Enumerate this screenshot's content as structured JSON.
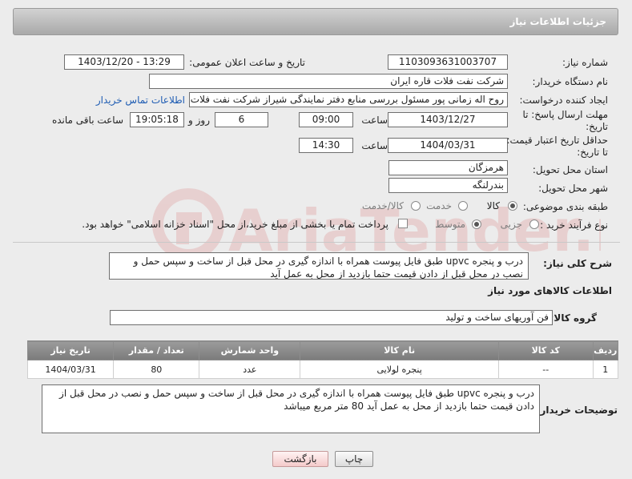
{
  "header": {
    "title": "جزئیات اطلاعات نیاز"
  },
  "form": {
    "need_number_label": "شماره نیاز:",
    "need_number": "1103093631003707",
    "announce_label": "تاریخ و ساعت اعلان عمومی:",
    "announce_value": "1403/12/20 - 13:29",
    "buyer_org_label": "نام دستگاه خریدار:",
    "buyer_org": "شرکت نفت فلات قاره ایران",
    "creator_label": "ایجاد کننده درخواست:",
    "creator": "روح اله زمانی پور مسئول بررسی منابع دفتر نمایندگی شیراز شرکت نفت فلات ق",
    "contact_link": "اطلاعات تماس خریدار",
    "deadline_label": "مهلت ارسال پاسخ: تا تاریخ:",
    "deadline_date": "1403/12/27",
    "time_label": "ساعت",
    "deadline_time": "09:00",
    "days_value": "6",
    "days_label": "روز و",
    "remaining_time": "19:05:18",
    "remaining_label": "ساعت باقی مانده",
    "validity_label": "حداقل تاریخ اعتبار قیمت: تا تاریخ:",
    "validity_date": "1404/03/31",
    "validity_time_label": "ساعت",
    "validity_time": "14:30",
    "province_label": "استان محل تحویل:",
    "province": "هرمزگان",
    "city_label": "شهر محل تحویل:",
    "city": "بندرلنگه",
    "category_label": "طبقه بندی موضوعی:",
    "category_options": [
      "کالا",
      "خدمت",
      "کالا/خدمت"
    ],
    "process_label": "نوع فرآیند خرید :",
    "process_options": [
      "جزیی",
      "متوسط"
    ],
    "payment_note": "پرداخت تمام یا بخشی از مبلغ خرید،از محل \"اسناد خزانه اسلامی\" خواهد بود."
  },
  "description": {
    "label": "شرح کلی نیاز:",
    "text": "درب و پنجره upvc طبق فایل پیوست همراه با اندازه گیری در محل قبل از ساخت و سپس حمل و نصب در محل قبل از دادن قیمت حتما بازدید از محل به عمل آید"
  },
  "goods": {
    "section_title": "اطلاعات کالاهای مورد نیاز",
    "group_label": "گروه کالا:",
    "group_value": "فن آوریهای ساخت و تولید",
    "columns": [
      "ردیف",
      "کد کالا",
      "نام کالا",
      "واحد شمارش",
      "تعداد / مقدار",
      "تاریخ نیاز"
    ],
    "rows": [
      [
        "1",
        "--",
        "پنجره لولایی",
        "عدد",
        "80",
        "1404/03/31"
      ]
    ]
  },
  "buyer_notes": {
    "label": "توضیحات خریدار:",
    "text": "درب و پنجره upvc طبق فایل پیوست همراه با اندازه گیری در محل قبل از ساخت و سپس حمل و نصب در محل قبل از دادن قیمت حتما بازدید از محل به عمل آید 80 متر مربع میباشد"
  },
  "buttons": {
    "print": "چاپ",
    "back": "بازگشت"
  },
  "watermark": {
    "text": "AriaTender.neT"
  },
  "colors": {
    "link": "#1e5cb3",
    "header_bg": "#a9a9a9",
    "table_header": "#8a8a8a",
    "watermark": "#e4b9b9"
  }
}
